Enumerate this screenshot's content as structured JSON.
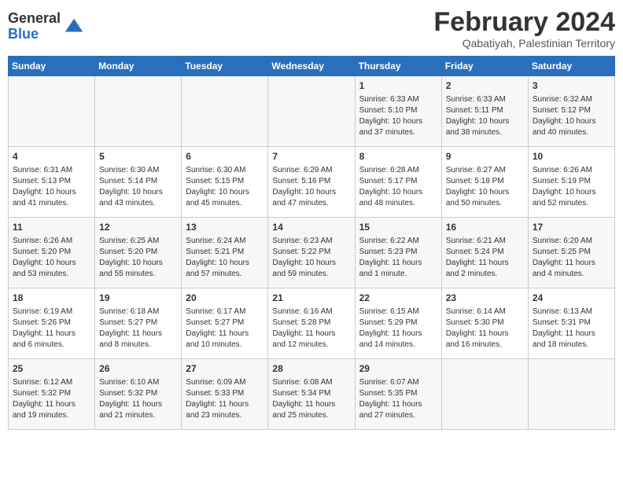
{
  "logo": {
    "general": "General",
    "blue": "Blue"
  },
  "header": {
    "month": "February 2024",
    "location": "Qabatiyah, Palestinian Territory"
  },
  "days_of_week": [
    "Sunday",
    "Monday",
    "Tuesday",
    "Wednesday",
    "Thursday",
    "Friday",
    "Saturday"
  ],
  "weeks": [
    [
      {
        "day": "",
        "info": ""
      },
      {
        "day": "",
        "info": ""
      },
      {
        "day": "",
        "info": ""
      },
      {
        "day": "",
        "info": ""
      },
      {
        "day": "1",
        "info": "Sunrise: 6:33 AM\nSunset: 5:10 PM\nDaylight: 10 hours\nand 37 minutes."
      },
      {
        "day": "2",
        "info": "Sunrise: 6:33 AM\nSunset: 5:11 PM\nDaylight: 10 hours\nand 38 minutes."
      },
      {
        "day": "3",
        "info": "Sunrise: 6:32 AM\nSunset: 5:12 PM\nDaylight: 10 hours\nand 40 minutes."
      }
    ],
    [
      {
        "day": "4",
        "info": "Sunrise: 6:31 AM\nSunset: 5:13 PM\nDaylight: 10 hours\nand 41 minutes."
      },
      {
        "day": "5",
        "info": "Sunrise: 6:30 AM\nSunset: 5:14 PM\nDaylight: 10 hours\nand 43 minutes."
      },
      {
        "day": "6",
        "info": "Sunrise: 6:30 AM\nSunset: 5:15 PM\nDaylight: 10 hours\nand 45 minutes."
      },
      {
        "day": "7",
        "info": "Sunrise: 6:29 AM\nSunset: 5:16 PM\nDaylight: 10 hours\nand 47 minutes."
      },
      {
        "day": "8",
        "info": "Sunrise: 6:28 AM\nSunset: 5:17 PM\nDaylight: 10 hours\nand 48 minutes."
      },
      {
        "day": "9",
        "info": "Sunrise: 6:27 AM\nSunset: 5:18 PM\nDaylight: 10 hours\nand 50 minutes."
      },
      {
        "day": "10",
        "info": "Sunrise: 6:26 AM\nSunset: 5:19 PM\nDaylight: 10 hours\nand 52 minutes."
      }
    ],
    [
      {
        "day": "11",
        "info": "Sunrise: 6:26 AM\nSunset: 5:20 PM\nDaylight: 10 hours\nand 53 minutes."
      },
      {
        "day": "12",
        "info": "Sunrise: 6:25 AM\nSunset: 5:20 PM\nDaylight: 10 hours\nand 55 minutes."
      },
      {
        "day": "13",
        "info": "Sunrise: 6:24 AM\nSunset: 5:21 PM\nDaylight: 10 hours\nand 57 minutes."
      },
      {
        "day": "14",
        "info": "Sunrise: 6:23 AM\nSunset: 5:22 PM\nDaylight: 10 hours\nand 59 minutes."
      },
      {
        "day": "15",
        "info": "Sunrise: 6:22 AM\nSunset: 5:23 PM\nDaylight: 11 hours\nand 1 minute."
      },
      {
        "day": "16",
        "info": "Sunrise: 6:21 AM\nSunset: 5:24 PM\nDaylight: 11 hours\nand 2 minutes."
      },
      {
        "day": "17",
        "info": "Sunrise: 6:20 AM\nSunset: 5:25 PM\nDaylight: 11 hours\nand 4 minutes."
      }
    ],
    [
      {
        "day": "18",
        "info": "Sunrise: 6:19 AM\nSunset: 5:26 PM\nDaylight: 11 hours\nand 6 minutes."
      },
      {
        "day": "19",
        "info": "Sunrise: 6:18 AM\nSunset: 5:27 PM\nDaylight: 11 hours\nand 8 minutes."
      },
      {
        "day": "20",
        "info": "Sunrise: 6:17 AM\nSunset: 5:27 PM\nDaylight: 11 hours\nand 10 minutes."
      },
      {
        "day": "21",
        "info": "Sunrise: 6:16 AM\nSunset: 5:28 PM\nDaylight: 11 hours\nand 12 minutes."
      },
      {
        "day": "22",
        "info": "Sunrise: 6:15 AM\nSunset: 5:29 PM\nDaylight: 11 hours\nand 14 minutes."
      },
      {
        "day": "23",
        "info": "Sunrise: 6:14 AM\nSunset: 5:30 PM\nDaylight: 11 hours\nand 16 minutes."
      },
      {
        "day": "24",
        "info": "Sunrise: 6:13 AM\nSunset: 5:31 PM\nDaylight: 11 hours\nand 18 minutes."
      }
    ],
    [
      {
        "day": "25",
        "info": "Sunrise: 6:12 AM\nSunset: 5:32 PM\nDaylight: 11 hours\nand 19 minutes."
      },
      {
        "day": "26",
        "info": "Sunrise: 6:10 AM\nSunset: 5:32 PM\nDaylight: 11 hours\nand 21 minutes."
      },
      {
        "day": "27",
        "info": "Sunrise: 6:09 AM\nSunset: 5:33 PM\nDaylight: 11 hours\nand 23 minutes."
      },
      {
        "day": "28",
        "info": "Sunrise: 6:08 AM\nSunset: 5:34 PM\nDaylight: 11 hours\nand 25 minutes."
      },
      {
        "day": "29",
        "info": "Sunrise: 6:07 AM\nSunset: 5:35 PM\nDaylight: 11 hours\nand 27 minutes."
      },
      {
        "day": "",
        "info": ""
      },
      {
        "day": "",
        "info": ""
      }
    ]
  ]
}
